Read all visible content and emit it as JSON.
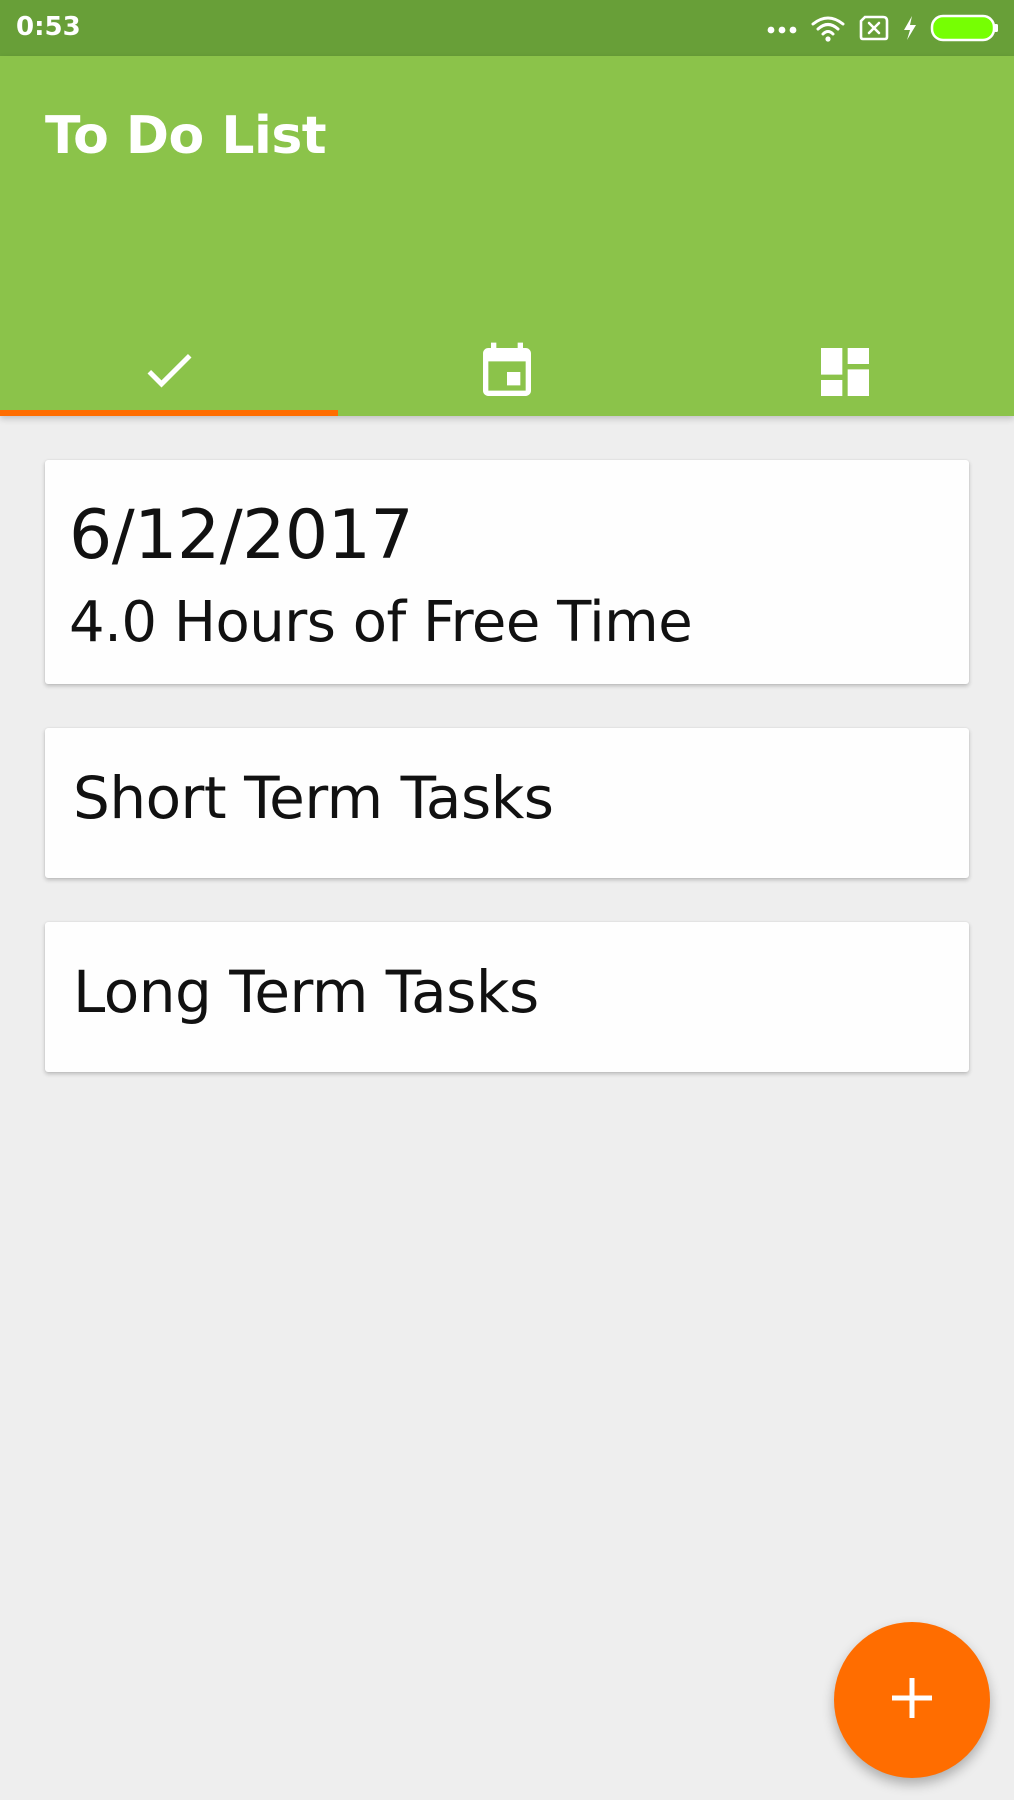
{
  "status_bar": {
    "time": "0:53",
    "icons": [
      "more-dots-icon",
      "wifi-icon",
      "no-sim-icon",
      "charging-bolt-icon",
      "battery-icon"
    ],
    "battery_color": "#76ff03"
  },
  "app_bar": {
    "title": "To Do List",
    "color": "#8bc34a",
    "status_color": "#689f38"
  },
  "tabs": [
    {
      "icon": "check-icon",
      "selected": true
    },
    {
      "icon": "calendar-icon",
      "selected": false
    },
    {
      "icon": "dashboard-icon",
      "selected": false
    }
  ],
  "accent_color": "#ff6d00",
  "cards": {
    "free_time": {
      "date": "6/12/2017",
      "hours_text": "4.0 Hours of Free Time"
    },
    "short_term": {
      "label": "Short Term Tasks"
    },
    "long_term": {
      "label": "Long Term Tasks"
    }
  },
  "fab": {
    "icon": "plus-icon"
  }
}
